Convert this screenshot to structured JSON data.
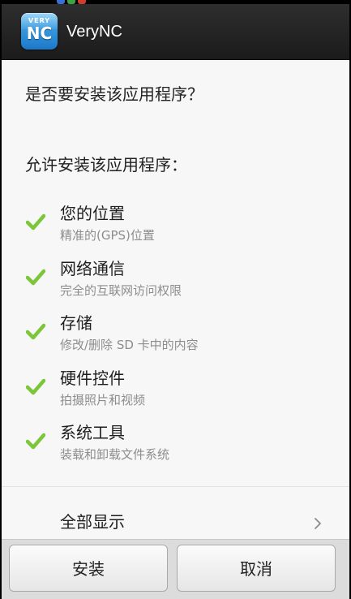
{
  "title_bar": {
    "app_name": "VeryNC",
    "icon": {
      "name": "verync-app-icon",
      "small_text": "VERY",
      "big_text": "NC",
      "color": "#2a8fdc"
    }
  },
  "prompt": {
    "question": "是否要安装该应用程序？",
    "allow_header": "允许安装该应用程序："
  },
  "permissions": [
    {
      "icon": "check-icon",
      "title": "您的位置",
      "description": "精准的(GPS)位置"
    },
    {
      "icon": "check-icon",
      "title": "网络通信",
      "description": "完全的互联网访问权限"
    },
    {
      "icon": "check-icon",
      "title": "存储",
      "description": "修改/删除 SD 卡中的内容"
    },
    {
      "icon": "check-icon",
      "title": "硬件控件",
      "description": "拍摄照片和视频"
    },
    {
      "icon": "check-icon",
      "title": "系统工具",
      "description": "装载和卸载文件系统"
    }
  ],
  "show_all": {
    "label": "全部显示",
    "icon": "chevron-right-icon"
  },
  "buttons": {
    "install": "安装",
    "cancel": "取消"
  },
  "colors": {
    "check_green": "#7cc63a",
    "title_bar_bg": "#252525",
    "content_bg": "#f7f7f7",
    "button_bar_bg": "#dcdcdc",
    "description_gray": "#8d8d8d"
  }
}
